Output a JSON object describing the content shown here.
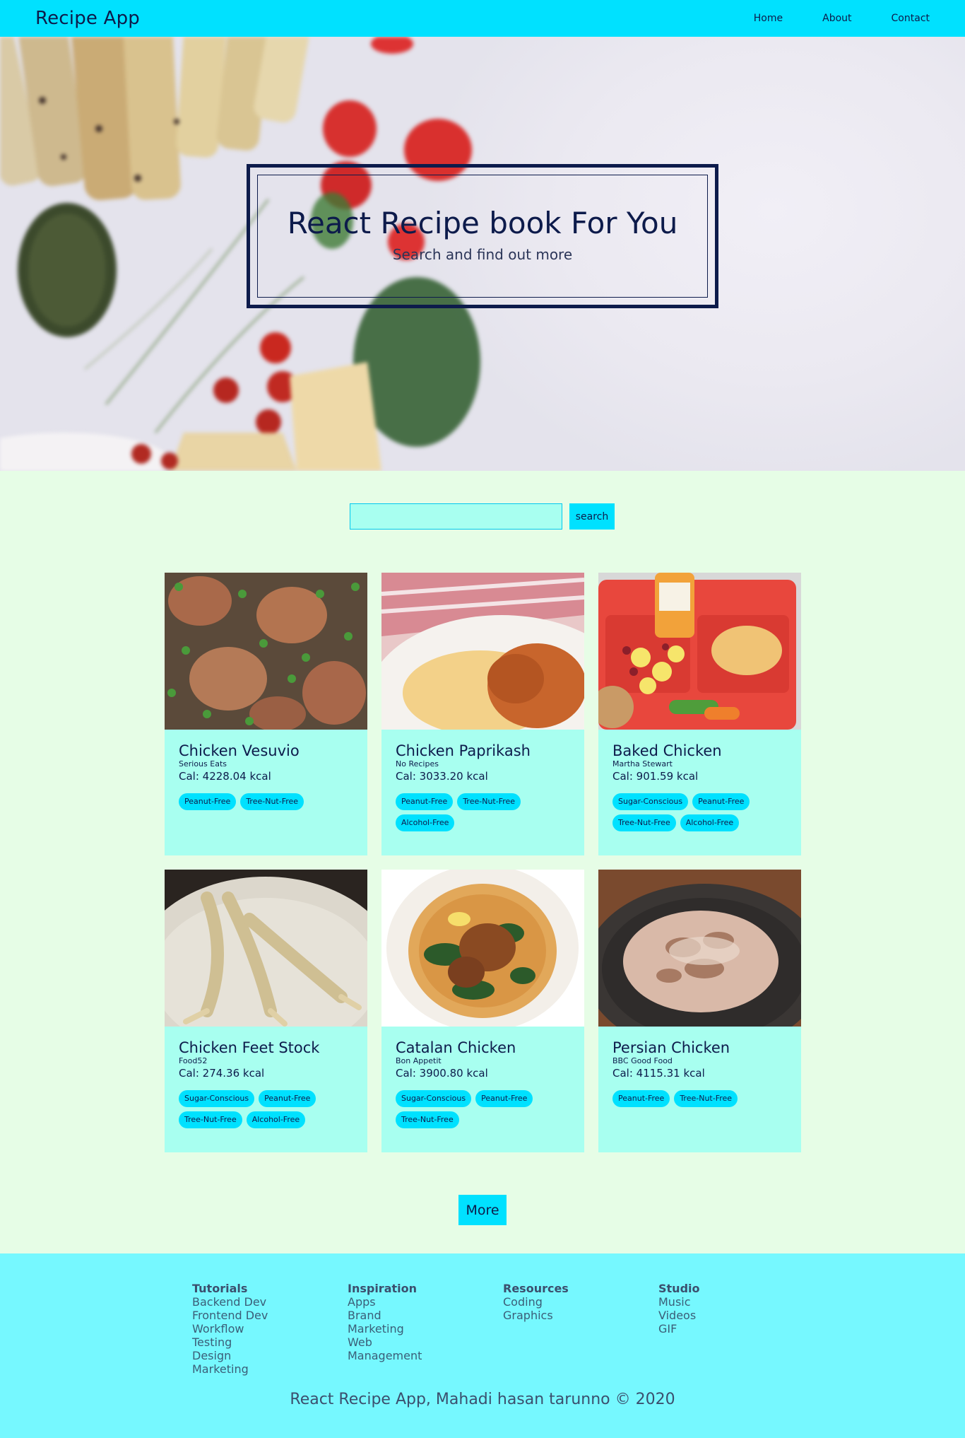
{
  "navbar": {
    "brand": "Recipe App",
    "links": [
      "Home",
      "About",
      "Contact"
    ]
  },
  "hero": {
    "title": "React Recipe book For You",
    "subtitle": "Search and find out more"
  },
  "search": {
    "value": "",
    "placeholder": "",
    "button_label": "search"
  },
  "recipes": [
    {
      "title": "Chicken Vesuvio",
      "source": "Serious Eats",
      "calories": "Cal: 4228.04 kcal",
      "tags": [
        "Peanut-Free",
        "Tree-Nut-Free"
      ]
    },
    {
      "title": "Chicken Paprikash",
      "source": "No Recipes",
      "calories": "Cal: 3033.20 kcal",
      "tags": [
        "Peanut-Free",
        "Tree-Nut-Free",
        "Alcohol-Free"
      ]
    },
    {
      "title": "Baked Chicken",
      "source": "Martha Stewart",
      "calories": "Cal: 901.59 kcal",
      "tags": [
        "Sugar-Conscious",
        "Peanut-Free",
        "Tree-Nut-Free",
        "Alcohol-Free"
      ]
    },
    {
      "title": "Chicken Feet Stock",
      "source": "Food52",
      "calories": "Cal: 274.36 kcal",
      "tags": [
        "Sugar-Conscious",
        "Peanut-Free",
        "Tree-Nut-Free",
        "Alcohol-Free"
      ]
    },
    {
      "title": "Catalan Chicken",
      "source": "Bon Appetit",
      "calories": "Cal: 3900.80 kcal",
      "tags": [
        "Sugar-Conscious",
        "Peanut-Free",
        "Tree-Nut-Free"
      ]
    },
    {
      "title": "Persian Chicken",
      "source": "BBC Good Food",
      "calories": "Cal: 4115.31 kcal",
      "tags": [
        "Peanut-Free",
        "Tree-Nut-Free"
      ]
    }
  ],
  "more_button": "More",
  "footer": {
    "columns": [
      {
        "heading": "Tutorials",
        "links": [
          "Backend Dev",
          "Frontend Dev",
          "Workflow",
          "Testing",
          "Design",
          "Marketing"
        ]
      },
      {
        "heading": "Inspiration",
        "links": [
          "Apps",
          "Brand",
          "Marketing",
          "Web",
          "Management"
        ]
      },
      {
        "heading": "Resources",
        "links": [
          "Coding",
          "Graphics"
        ]
      },
      {
        "heading": "Studio",
        "links": [
          "Music",
          "Videos",
          "GIF"
        ]
      }
    ],
    "copyright": "React Recipe App, Mahadi hasan tarunno © 2020"
  },
  "colors": {
    "accent": "#00e1ff",
    "card_bg": "#a8fff0",
    "page_bg": "#e6fde6",
    "footer_bg": "#76f8ff",
    "text": "#0d1b4b"
  }
}
